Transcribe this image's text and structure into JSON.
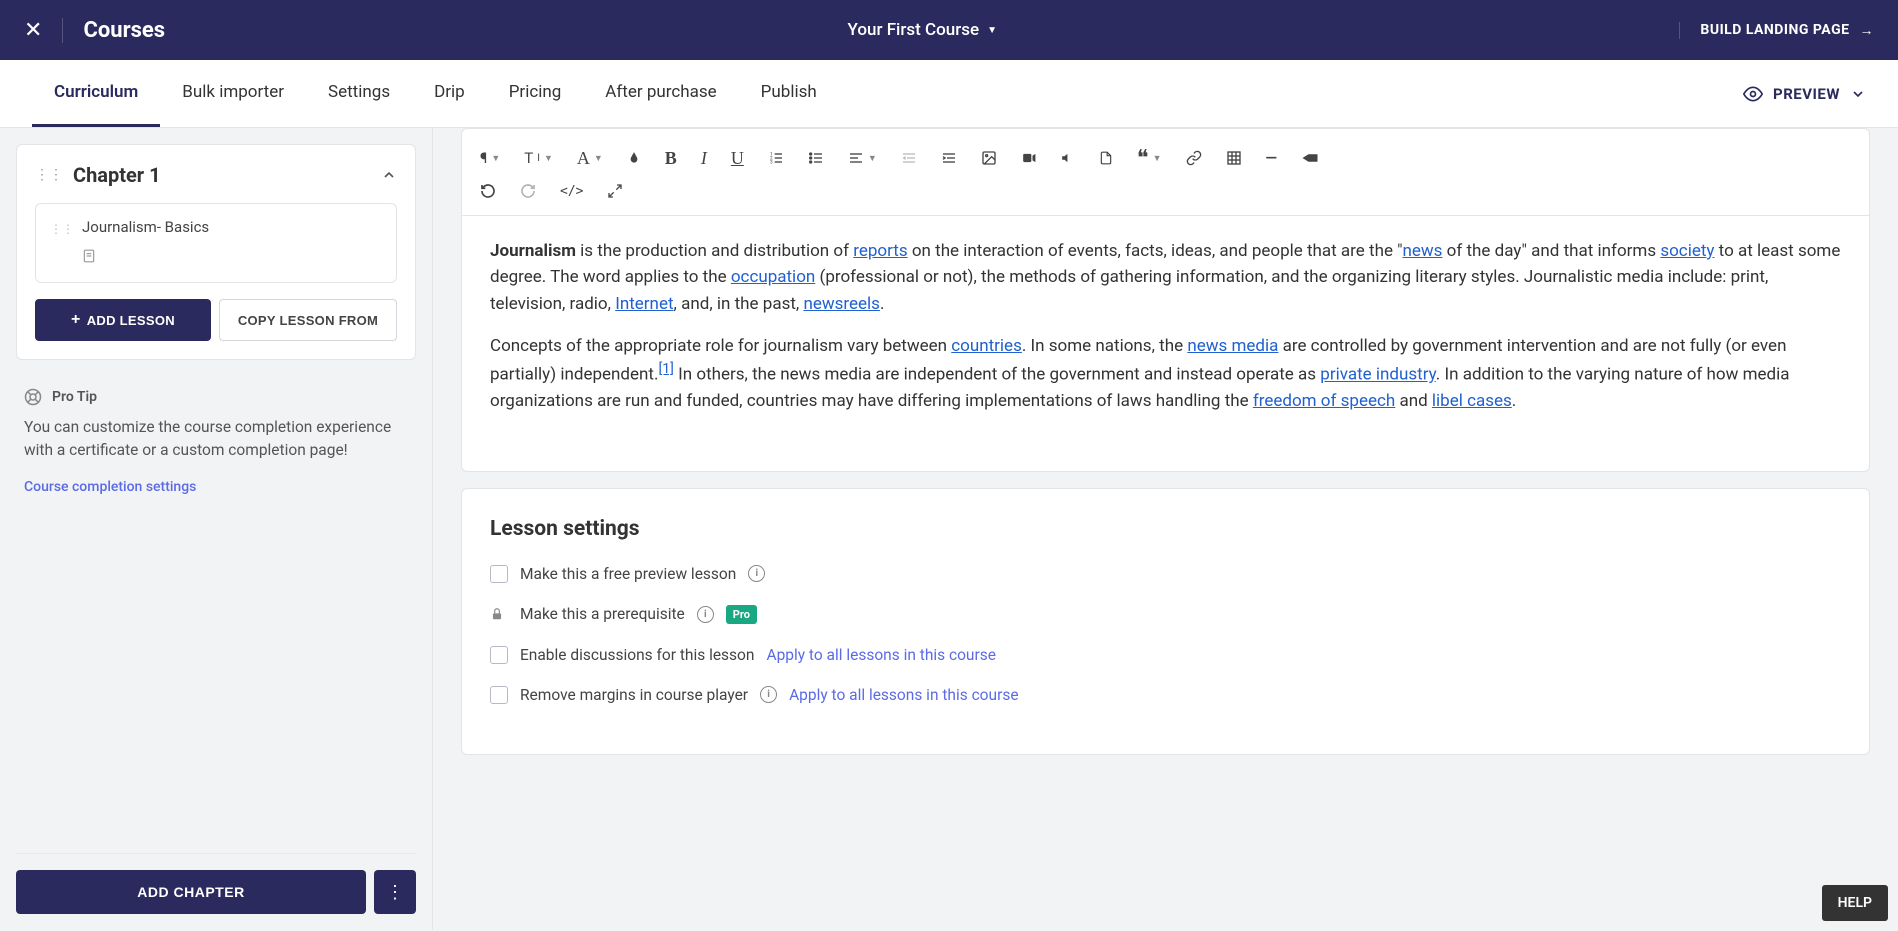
{
  "header": {
    "title": "Courses",
    "course_name": "Your First Course",
    "build_label": "BUILD LANDING PAGE"
  },
  "tabs": [
    "Curriculum",
    "Bulk importer",
    "Settings",
    "Drip",
    "Pricing",
    "After purchase",
    "Publish"
  ],
  "preview_label": "PREVIEW",
  "sidebar": {
    "chapter_title": "Chapter 1",
    "lesson_title": "Journalism- Basics",
    "add_lesson": "ADD LESSON",
    "copy_lesson": "COPY LESSON FROM",
    "pro_tip_label": "Pro Tip",
    "pro_tip_text": "You can customize the course completion experience with a certificate or a custom completion page!",
    "pro_tip_link": "Course completion settings",
    "add_chapter": "ADD CHAPTER"
  },
  "editor": {
    "p1": {
      "s1a": "Journalism",
      "s1b": " is the production and distribution of ",
      "link_reports": "reports",
      "s1c": " on the interaction of events, facts, ideas, and people that are the \"",
      "link_news": "news",
      "s1d": " of the day\" and that informs ",
      "link_society": "society",
      "s1e": " to at least some degree. The word applies to the ",
      "link_occupation": "occupation",
      "s1f": " (professional or not), the methods of gathering information, and the organizing literary styles. Journalistic media include: print, television, radio, ",
      "link_internet": "Internet",
      "s1g": ", and, in the past, ",
      "link_newsreels": "newsreels",
      "s1h": "."
    },
    "p2": {
      "s2a": "Concepts of the appropriate role for journalism vary between ",
      "link_countries": "countries",
      "s2b": ". In some nations, the ",
      "link_newsmedia": "news media",
      "s2c": " are controlled by government intervention and are not fully (or even partially) independent.",
      "cite": "[1]",
      "s2d": " In others, the news media are independent of the government and instead operate as ",
      "link_private": "private industry",
      "s2e": ". In addition to the varying nature of how media organizations are run and funded, countries may have differing implementations of laws handling the ",
      "link_freedom": "freedom of speech",
      "s2f": " and ",
      "link_libel": "libel cases",
      "s2g": "."
    }
  },
  "settings": {
    "title": "Lesson settings",
    "free_preview": "Make this a free preview lesson",
    "prerequisite": "Make this a prerequisite",
    "pro_badge": "Pro",
    "discussions": "Enable discussions for this lesson",
    "remove_margins": "Remove margins in course player",
    "apply_all": "Apply to all lessons in this course"
  },
  "help": "HELP"
}
